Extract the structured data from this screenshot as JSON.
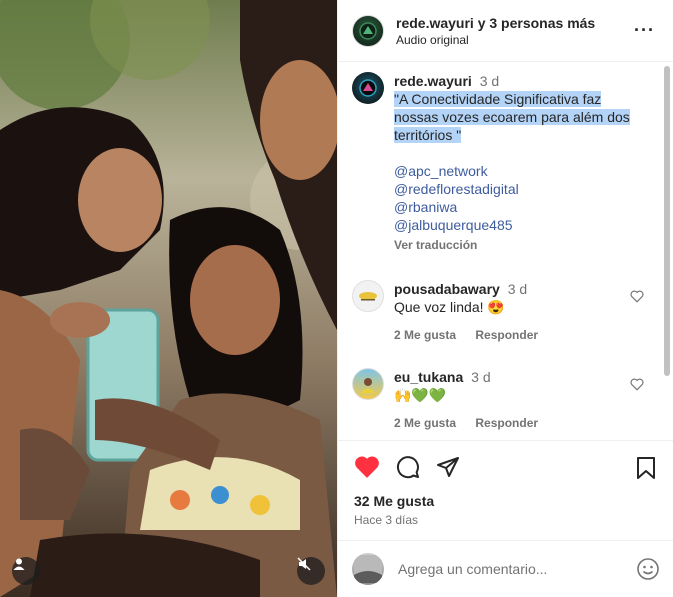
{
  "header": {
    "title": "rede.wayuri y 3 personas más",
    "subtitle": "Audio original",
    "menu_icon": "more-dots-icon"
  },
  "caption": {
    "user": "rede.wayuri",
    "time": "3 d",
    "text": "\"A Conectividade Significativa faz nossas vozes ecoarem para além dos territórios \"",
    "mentions": [
      "@apc_network",
      "@redeflorestadigital",
      "@rbaniwa",
      "@jalbuquerque485"
    ],
    "translate": "Ver traducción"
  },
  "comments": [
    {
      "user": "pousadabawary",
      "time": "3 d",
      "text": "Que voz linda! 😍",
      "likes": "2 Me gusta",
      "reply": "Responder"
    },
    {
      "user": "eu_tukana",
      "time": "3 d",
      "text": "🙌💚💚",
      "likes": "2 Me gusta",
      "reply": "Responder"
    }
  ],
  "post": {
    "likes": "32 Me gusta",
    "date": "Hace 3 días"
  },
  "composer": {
    "placeholder": "Agrega un comentario..."
  },
  "colors": {
    "like_red": "#ff3040",
    "mention_blue": "#3e5c9e",
    "selection": "#b3d3f7"
  }
}
